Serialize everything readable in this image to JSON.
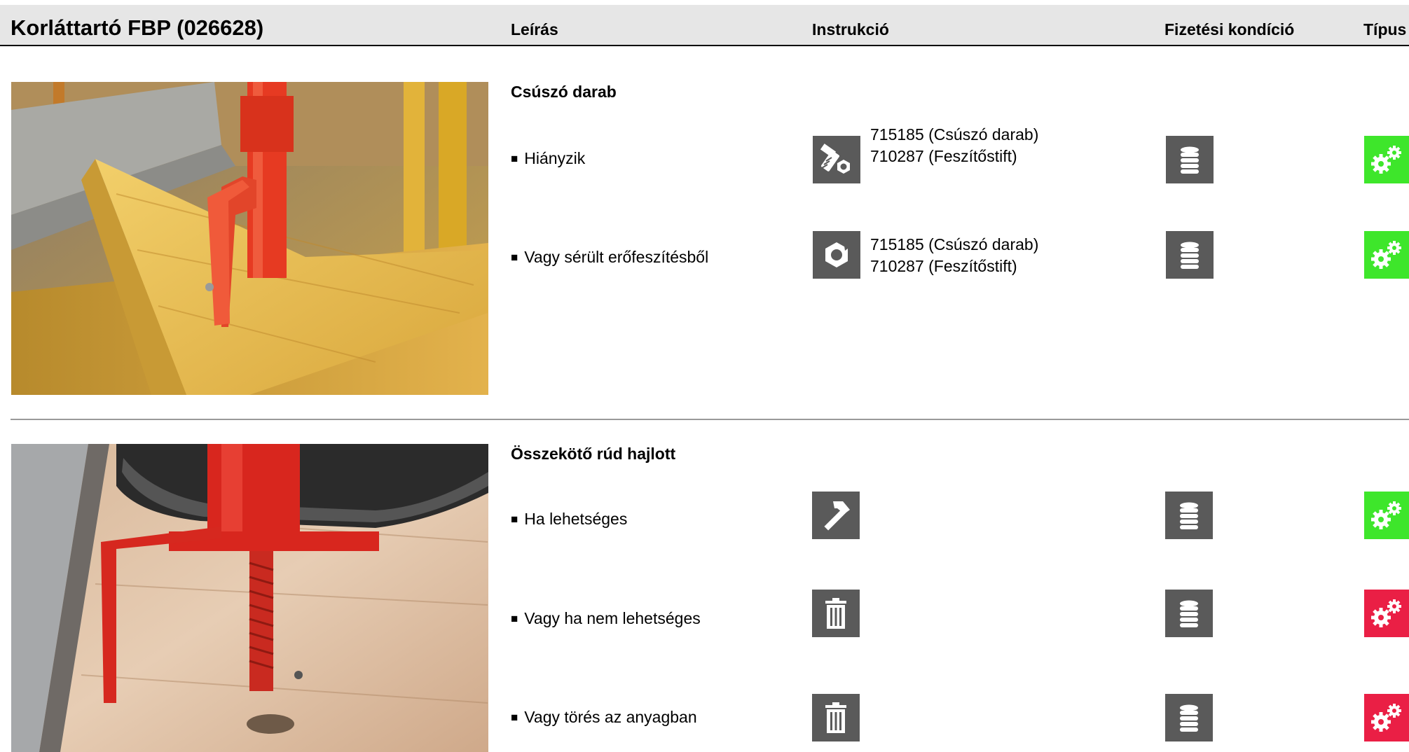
{
  "header": {
    "title": "Korláttartó FBP (026628)",
    "col_description": "Leírás",
    "col_instruction": "Instrukció",
    "col_payment": "Fizetési kondíció",
    "col_type": "Típus"
  },
  "sections": [
    {
      "title": "Csúszó darab",
      "rows": [
        {
          "description": "Hiányzik",
          "instruction_icon": "bolt-nut-icon",
          "instruction_lines": [
            "715185 (Csúszó darab)",
            "710287 (Feszítőstift)"
          ],
          "payment_icon": "coin-stack-icon",
          "type_icon": "gears-icon",
          "type_color": "#3ee62b"
        },
        {
          "description": "Vagy sérült erőfeszítésből",
          "instruction_icon": "damaged-nut-icon",
          "instruction_lines": [
            "715185 (Csúszó darab)",
            "710287 (Feszítőstift)"
          ],
          "payment_icon": "coin-stack-icon",
          "type_icon": "gears-icon",
          "type_color": "#3ee62b"
        }
      ]
    },
    {
      "title": "Összekötő rúd hajlott",
      "rows": [
        {
          "description": "Ha lehetséges",
          "instruction_icon": "hammer-icon",
          "payment_icon": "coin-stack-icon",
          "type_icon": "gears-icon",
          "type_color": "#3ee62b"
        },
        {
          "description": "Vagy ha nem lehetséges",
          "instruction_icon": "trash-icon",
          "payment_icon": "coin-stack-icon",
          "type_icon": "gears-icon",
          "type_color": "#ea1f45"
        },
        {
          "description": "Vagy törés az anyagban",
          "instruction_icon": "trash-icon",
          "payment_icon": "coin-stack-icon",
          "type_icon": "gears-icon",
          "type_color": "#ea1f45"
        }
      ]
    }
  ],
  "colors": {
    "header_bg": "#e6e6e6",
    "icon_bg": "#5a5a5a",
    "type_green": "#3ee62b",
    "type_red": "#ea1f45"
  }
}
